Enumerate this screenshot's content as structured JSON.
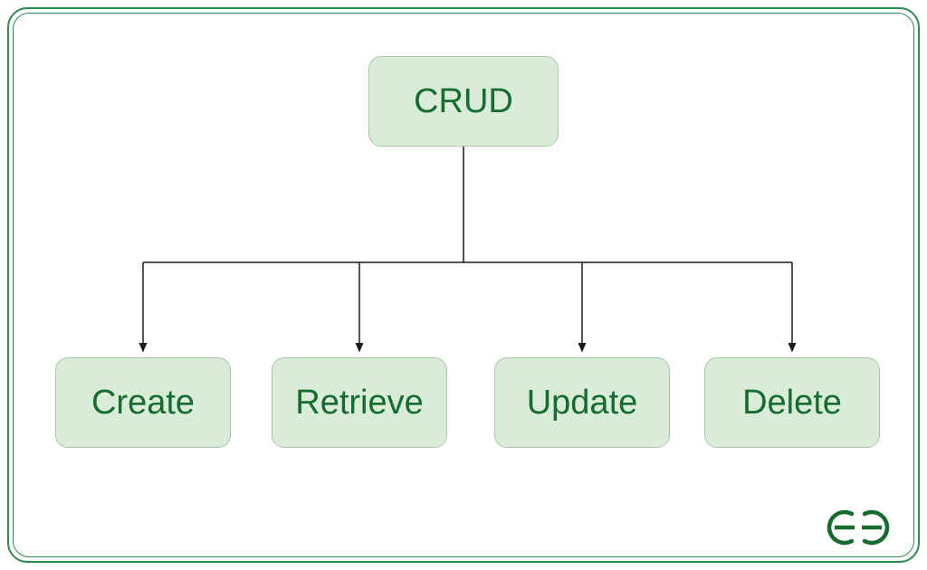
{
  "colors": {
    "frame_border": "#2d8a4e",
    "node_fill": "#d8ecd8",
    "node_border": "#a8c8a8",
    "text": "#166b2f",
    "connector": "#1a1a1a"
  },
  "diagram": {
    "root": {
      "label": "CRUD"
    },
    "children": [
      {
        "label": "Create"
      },
      {
        "label": "Retrieve"
      },
      {
        "label": "Update"
      },
      {
        "label": "Delete"
      }
    ]
  },
  "logo": {
    "name": "geeksforgeeks-logo"
  }
}
